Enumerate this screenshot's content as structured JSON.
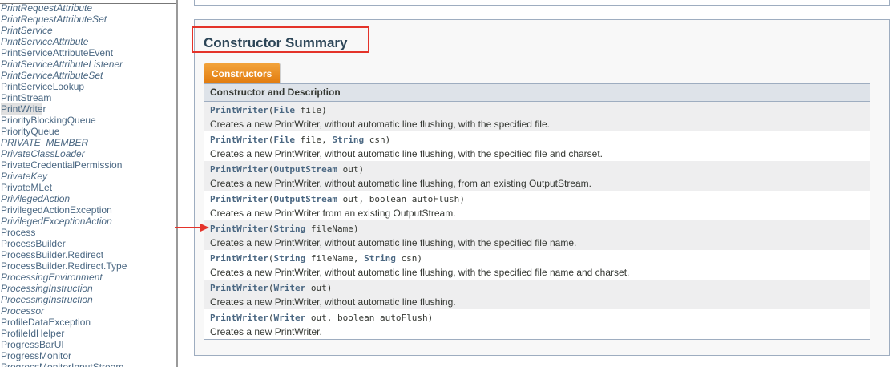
{
  "class_list": [
    {
      "label": "PrintRequestAttribute",
      "italic": true
    },
    {
      "label": "PrintRequestAttributeSet",
      "italic": true
    },
    {
      "label": "PrintService",
      "italic": true
    },
    {
      "label": "PrintServiceAttribute",
      "italic": true
    },
    {
      "label": "PrintServiceAttributeEvent",
      "italic": false
    },
    {
      "label": "PrintServiceAttributeListener",
      "italic": true
    },
    {
      "label": "PrintServiceAttributeSet",
      "italic": true
    },
    {
      "label": "PrintServiceLookup",
      "italic": false
    },
    {
      "label": "PrintStream",
      "italic": false
    },
    {
      "label": "PrintWriter",
      "italic": false,
      "current": true
    },
    {
      "label": "PriorityBlockingQueue",
      "italic": false
    },
    {
      "label": "PriorityQueue",
      "italic": false
    },
    {
      "label": "PRIVATE_MEMBER",
      "italic": true
    },
    {
      "label": "PrivateClassLoader",
      "italic": true
    },
    {
      "label": "PrivateCredentialPermission",
      "italic": false
    },
    {
      "label": "PrivateKey",
      "italic": true
    },
    {
      "label": "PrivateMLet",
      "italic": false
    },
    {
      "label": "PrivilegedAction",
      "italic": true
    },
    {
      "label": "PrivilegedActionException",
      "italic": false
    },
    {
      "label": "PrivilegedExceptionAction",
      "italic": true
    },
    {
      "label": "Process",
      "italic": false
    },
    {
      "label": "ProcessBuilder",
      "italic": false
    },
    {
      "label": "ProcessBuilder.Redirect",
      "italic": false
    },
    {
      "label": "ProcessBuilder.Redirect.Type",
      "italic": false
    },
    {
      "label": "ProcessingEnvironment",
      "italic": true
    },
    {
      "label": "ProcessingInstruction",
      "italic": true
    },
    {
      "label": "ProcessingInstruction",
      "italic": true
    },
    {
      "label": "Processor",
      "italic": true
    },
    {
      "label": "ProfileDataException",
      "italic": false
    },
    {
      "label": "ProfileIdHelper",
      "italic": false
    },
    {
      "label": "ProgressBarUI",
      "italic": false
    },
    {
      "label": "ProgressMonitor",
      "italic": false
    },
    {
      "label": "ProgressMonitorInputStream",
      "italic": false
    }
  ],
  "summary": {
    "title": "Constructor Summary",
    "tab_label": "Constructors",
    "table_header": "Constructor and Description",
    "accent_color": "#e4332a",
    "rows": [
      {
        "name": "PrintWriter",
        "params": [
          {
            "type": "File",
            "name": "file"
          }
        ],
        "desc": "Creates a new PrintWriter, without automatic line flushing, with the specified file."
      },
      {
        "name": "PrintWriter",
        "params": [
          {
            "type": "File",
            "name": "file"
          },
          {
            "type": "String",
            "name": "csn"
          }
        ],
        "desc": "Creates a new PrintWriter, without automatic line flushing, with the specified file and charset."
      },
      {
        "name": "PrintWriter",
        "params": [
          {
            "type": "OutputStream",
            "name": "out"
          }
        ],
        "desc": "Creates a new PrintWriter, without automatic line flushing, from an existing OutputStream."
      },
      {
        "name": "PrintWriter",
        "params": [
          {
            "type": "OutputStream",
            "name": "out"
          },
          {
            "plain": "boolean",
            "name": "autoFlush"
          }
        ],
        "desc": "Creates a new PrintWriter from an existing OutputStream."
      },
      {
        "name": "PrintWriter",
        "params": [
          {
            "type": "String",
            "name": "fileName"
          }
        ],
        "desc": "Creates a new PrintWriter, without automatic line flushing, with the specified file name."
      },
      {
        "name": "PrintWriter",
        "params": [
          {
            "type": "String",
            "name": "fileName"
          },
          {
            "type": "String",
            "name": "csn"
          }
        ],
        "desc": "Creates a new PrintWriter, without automatic line flushing, with the specified file name and charset."
      },
      {
        "name": "PrintWriter",
        "params": [
          {
            "type": "Writer",
            "name": "out"
          }
        ],
        "desc": "Creates a new PrintWriter, without automatic line flushing."
      },
      {
        "name": "PrintWriter",
        "params": [
          {
            "type": "Writer",
            "name": "out"
          },
          {
            "plain": "boolean",
            "name": "autoFlush"
          }
        ],
        "desc": "Creates a new PrintWriter."
      }
    ]
  }
}
